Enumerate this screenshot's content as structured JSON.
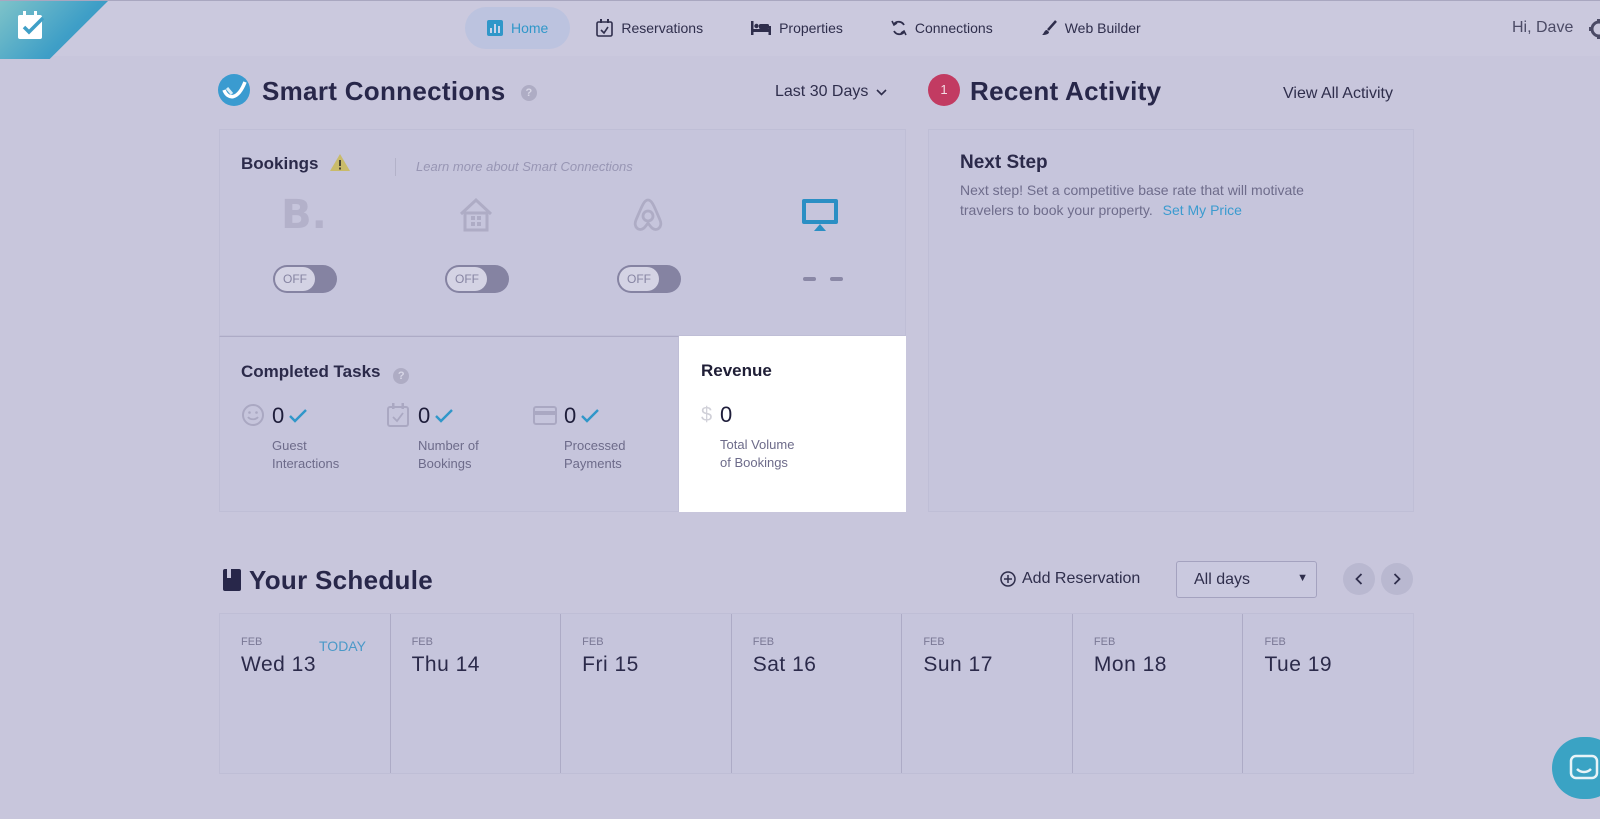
{
  "nav": {
    "items": [
      {
        "label": "Home",
        "icon": "bar-chart-icon",
        "active": true
      },
      {
        "label": "Reservations",
        "icon": "calendar-check-icon",
        "active": false
      },
      {
        "label": "Properties",
        "icon": "bed-icon",
        "active": false
      },
      {
        "label": "Connections",
        "icon": "sync-icon",
        "active": false
      },
      {
        "label": "Web Builder",
        "icon": "brush-icon",
        "active": false
      }
    ],
    "greeting": "Hi, Dave"
  },
  "smart_connections": {
    "title": "Smart Connections",
    "help": "?",
    "range": "Last 30 Days",
    "bookings": {
      "title": "Bookings",
      "learn_more": "Learn more about Smart Connections",
      "channels": [
        {
          "name": "booking-com",
          "icon": "booking-b-icon",
          "toggle": "OFF"
        },
        {
          "name": "homeaway",
          "icon": "house-icon",
          "toggle": "OFF"
        },
        {
          "name": "airbnb",
          "icon": "airbnb-icon",
          "toggle": "OFF"
        },
        {
          "name": "website",
          "icon": "monitor-icon",
          "toggle": "– –"
        }
      ]
    },
    "completed_tasks": {
      "title": "Completed Tasks",
      "help": "?",
      "items": [
        {
          "value": "0",
          "label_line1": "Guest",
          "label_line2": "Interactions",
          "icon": "smiley-icon"
        },
        {
          "value": "0",
          "label_line1": "Number of",
          "label_line2": "Bookings",
          "icon": "calendar-check-icon"
        },
        {
          "value": "0",
          "label_line1": "Processed",
          "label_line2": "Payments",
          "icon": "credit-card-icon"
        }
      ]
    },
    "revenue": {
      "title": "Revenue",
      "currency": "$",
      "value": "0",
      "label_line1": "Total Volume",
      "label_line2": "of Bookings"
    }
  },
  "recent_activity": {
    "count": "1",
    "title": "Recent Activity",
    "view_all": "View All Activity",
    "next_step": {
      "title": "Next Step",
      "text": "Next step! Set a competitive base rate that will motivate travelers to book your property.",
      "link": "Set My Price"
    }
  },
  "schedule": {
    "title": "Your Schedule",
    "add_label": "Add Reservation",
    "filter": "All days",
    "today_label": "TODAY",
    "days": [
      {
        "month": "FEB",
        "name": "Wed 13",
        "today": true
      },
      {
        "month": "FEB",
        "name": "Thu 14",
        "today": false
      },
      {
        "month": "FEB",
        "name": "Fri 15",
        "today": false
      },
      {
        "month": "FEB",
        "name": "Sat 16",
        "today": false
      },
      {
        "month": "FEB",
        "name": "Sun 17",
        "today": false
      },
      {
        "month": "FEB",
        "name": "Mon 18",
        "today": false
      },
      {
        "month": "FEB",
        "name": "Tue 19",
        "today": false
      }
    ]
  },
  "colors": {
    "accent": "#3097c9",
    "badge": "#c23b62",
    "background": "#c8c6dc"
  }
}
